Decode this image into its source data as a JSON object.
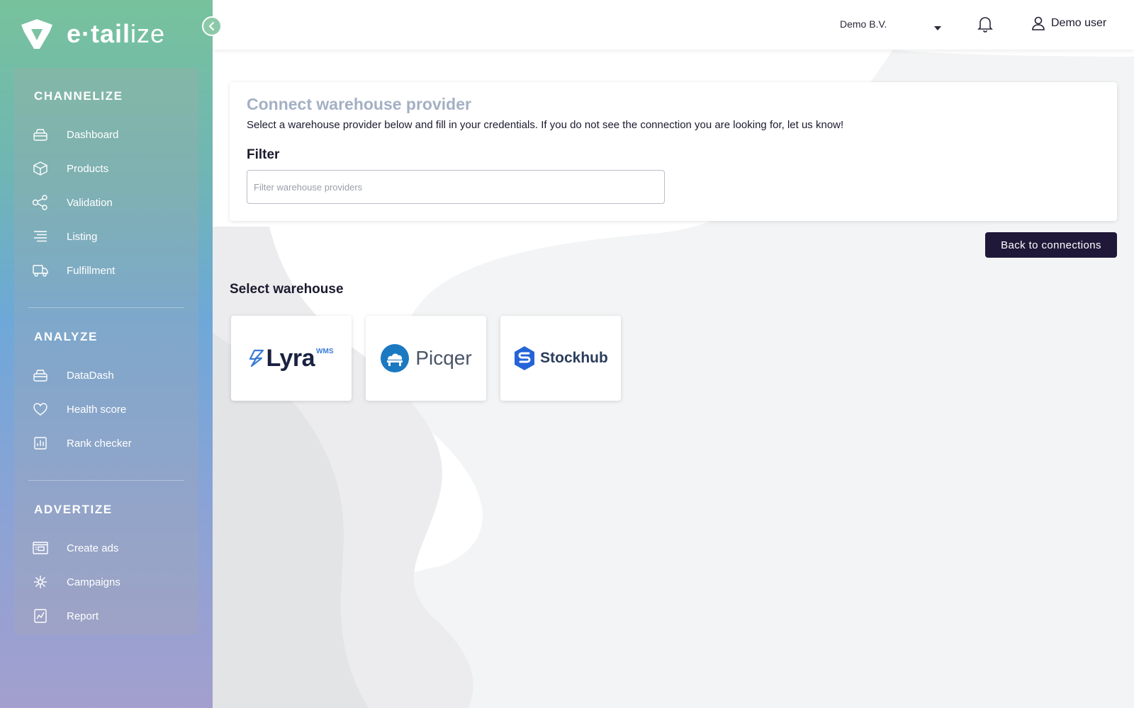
{
  "brand": {
    "logo_text_bold": "e·tail",
    "logo_text_light": "ize"
  },
  "sidebar": {
    "sections": [
      {
        "title": "CHANNELIZE",
        "items": [
          {
            "label": "Dashboard",
            "icon": "dashboard-icon"
          },
          {
            "label": "Products",
            "icon": "box-icon"
          },
          {
            "label": "Validation",
            "icon": "share-nodes-icon"
          },
          {
            "label": "Listing",
            "icon": "list-icon"
          },
          {
            "label": "Fulfillment",
            "icon": "truck-icon"
          }
        ]
      },
      {
        "title": "ANALYZE",
        "items": [
          {
            "label": "DataDash",
            "icon": "database-icon"
          },
          {
            "label": "Health score",
            "icon": "heart-icon"
          },
          {
            "label": "Rank checker",
            "icon": "bar-chart-icon"
          }
        ]
      },
      {
        "title": "ADVERTIZE",
        "items": [
          {
            "label": "Create ads",
            "icon": "ad-icon"
          },
          {
            "label": "Campaigns",
            "icon": "network-icon"
          },
          {
            "label": "Report",
            "icon": "report-icon"
          }
        ]
      }
    ]
  },
  "topbar": {
    "company": "Demo B.V.",
    "user": "Demo user"
  },
  "card": {
    "title": "Connect warehouse provider",
    "description": "Select a warehouse provider below and fill in your credentials. If you do not see the connection you are looking for, let us know!",
    "filter_label": "Filter",
    "filter_placeholder": "Filter warehouse providers",
    "filter_value": ""
  },
  "back_button": "Back to connections",
  "select_title": "Select warehouse",
  "providers": [
    {
      "name": "Lyra",
      "superscript": "WMS"
    },
    {
      "name": "Picqer"
    },
    {
      "name": "Stockhub"
    }
  ],
  "colors": {
    "primary_dark": "#1f1838",
    "title_muted": "#a4b0c4",
    "sidebar_top": "#77c29c",
    "sidebar_bottom": "#a39fce"
  }
}
